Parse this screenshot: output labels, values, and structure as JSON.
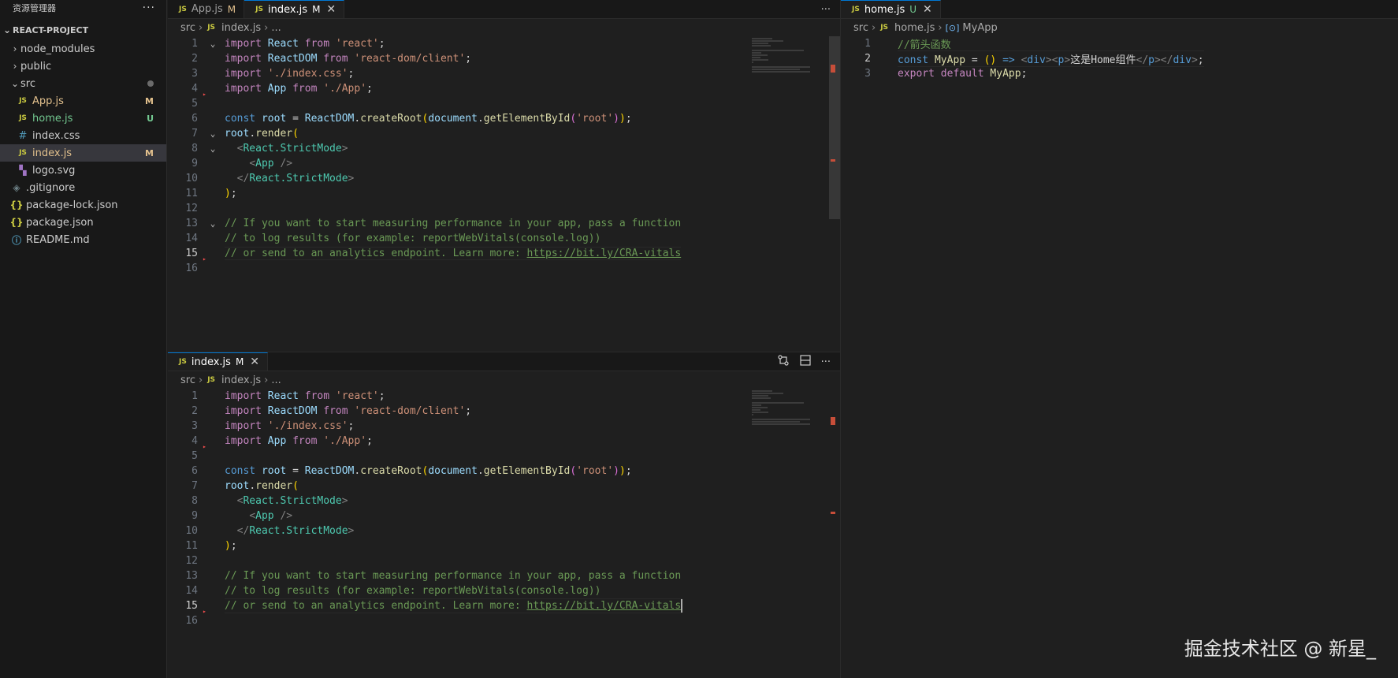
{
  "sidebar": {
    "title": "资源管理器",
    "more": "···",
    "project": "REACT-PROJECT",
    "items": [
      {
        "label": "node_modules",
        "type": "folder",
        "expanded": false
      },
      {
        "label": "public",
        "type": "folder",
        "expanded": false
      },
      {
        "label": "src",
        "type": "folder",
        "expanded": true
      },
      {
        "label": "App.js",
        "type": "js",
        "badge": "M"
      },
      {
        "label": "home.js",
        "type": "js",
        "badge": "U"
      },
      {
        "label": "index.css",
        "type": "css"
      },
      {
        "label": "index.js",
        "type": "js",
        "badge": "M"
      },
      {
        "label": "logo.svg",
        "type": "svg"
      },
      {
        "label": ".gitignore",
        "type": "git"
      },
      {
        "label": "package-lock.json",
        "type": "json"
      },
      {
        "label": "package.json",
        "type": "json"
      },
      {
        "label": "README.md",
        "type": "info"
      }
    ]
  },
  "icons": {
    "js": "JS",
    "css": "#",
    "json": "{}",
    "svg": "svg-file-icon",
    "info": "info-icon",
    "git": "git-icon",
    "chevron_right": "›",
    "chevron_down": "⌄",
    "close": "✕",
    "more": "···",
    "symbol": "[⊙]"
  },
  "editor_top": {
    "tabs": [
      {
        "label": "App.js",
        "status": "M",
        "active": false
      },
      {
        "label": "index.js",
        "status": "M",
        "active": true
      }
    ],
    "breadcrumb": {
      "folder": "src",
      "file": "index.js",
      "tail": "..."
    }
  },
  "editor_bottom": {
    "tabs": [
      {
        "label": "index.js",
        "status": "M",
        "active": true
      }
    ],
    "breadcrumb": {
      "folder": "src",
      "file": "index.js",
      "tail": "..."
    }
  },
  "editor_right": {
    "tabs": [
      {
        "label": "home.js",
        "status": "U",
        "active": true
      }
    ],
    "breadcrumb": {
      "folder": "src",
      "file": "home.js",
      "symbol": "MyApp"
    }
  },
  "index_code": [
    [
      [
        "kw",
        "import"
      ],
      [
        "pl",
        " "
      ],
      [
        "id",
        "React"
      ],
      [
        "pl",
        " "
      ],
      [
        "kw",
        "from"
      ],
      [
        "pl",
        " "
      ],
      [
        "str",
        "'react'"
      ],
      [
        "pl",
        ";"
      ]
    ],
    [
      [
        "kw",
        "import"
      ],
      [
        "pl",
        " "
      ],
      [
        "id",
        "ReactDOM"
      ],
      [
        "pl",
        " "
      ],
      [
        "kw",
        "from"
      ],
      [
        "pl",
        " "
      ],
      [
        "str",
        "'react-dom/client'"
      ],
      [
        "pl",
        ";"
      ]
    ],
    [
      [
        "kw",
        "import"
      ],
      [
        "pl",
        " "
      ],
      [
        "str",
        "'./index.css'"
      ],
      [
        "pl",
        ";"
      ]
    ],
    [
      [
        "kw",
        "import"
      ],
      [
        "pl",
        " "
      ],
      [
        "id",
        "App"
      ],
      [
        "pl",
        " "
      ],
      [
        "kw",
        "from"
      ],
      [
        "pl",
        " "
      ],
      [
        "str",
        "'./App'"
      ],
      [
        "pl",
        ";"
      ]
    ],
    [],
    [
      [
        "kw2",
        "const"
      ],
      [
        "pl",
        " "
      ],
      [
        "id",
        "root"
      ],
      [
        "pl",
        " = "
      ],
      [
        "id",
        "ReactDOM"
      ],
      [
        "pl",
        "."
      ],
      [
        "fn",
        "createRoot"
      ],
      [
        "br",
        "("
      ],
      [
        "id",
        "document"
      ],
      [
        "pl",
        "."
      ],
      [
        "fn",
        "getElementById"
      ],
      [
        "br2",
        "("
      ],
      [
        "str",
        "'root'"
      ],
      [
        "br2",
        ")"
      ],
      [
        "br",
        ")"
      ],
      [
        "pl",
        ";"
      ]
    ],
    [
      [
        "id",
        "root"
      ],
      [
        "pl",
        "."
      ],
      [
        "fn",
        "render"
      ],
      [
        "br",
        "("
      ]
    ],
    [
      [
        "pl",
        "  "
      ],
      [
        "tag",
        "<"
      ],
      [
        "tagn",
        "React.StrictMode"
      ],
      [
        "tag",
        ">"
      ]
    ],
    [
      [
        "pl",
        "    "
      ],
      [
        "tag",
        "<"
      ],
      [
        "tagn",
        "App"
      ],
      [
        "pl",
        " "
      ],
      [
        "tag",
        "/>"
      ]
    ],
    [
      [
        "pl",
        "  "
      ],
      [
        "tag",
        "</"
      ],
      [
        "tagn",
        "React.StrictMode"
      ],
      [
        "tag",
        ">"
      ]
    ],
    [
      [
        "br",
        ")"
      ],
      [
        "pl",
        ";"
      ]
    ],
    [],
    [
      [
        "cm",
        "// If you want to start measuring performance in your app, pass a function"
      ]
    ],
    [
      [
        "cm",
        "// to log results (for example: reportWebVitals(console.log))"
      ]
    ],
    [
      [
        "cm",
        "// or send to an analytics endpoint. Learn more: "
      ],
      [
        "url",
        "https://bit.ly/CRA-vitals"
      ]
    ],
    []
  ],
  "home_code": [
    [
      [
        "cm",
        "//箭头函数"
      ]
    ],
    [
      [
        "kw2",
        "const"
      ],
      [
        "pl",
        " "
      ],
      [
        "fn",
        "MyApp"
      ],
      [
        "pl",
        " = "
      ],
      [
        "br",
        "()"
      ],
      [
        "pl",
        " "
      ],
      [
        "kw2",
        "=>"
      ],
      [
        "pl",
        " "
      ],
      [
        "tag",
        "<"
      ],
      [
        "tagh",
        "div"
      ],
      [
        "tag",
        "><"
      ],
      [
        "tagh",
        "p"
      ],
      [
        "tag",
        ">"
      ],
      [
        "txt",
        "这是Home组件"
      ],
      [
        "tag",
        "</"
      ],
      [
        "tagh",
        "p"
      ],
      [
        "tag",
        "></"
      ],
      [
        "tagh",
        "div"
      ],
      [
        "tag",
        ">"
      ],
      [
        "pl",
        ";"
      ]
    ],
    [
      [
        "kw",
        "export"
      ],
      [
        "pl",
        " "
      ],
      [
        "kw",
        "default"
      ],
      [
        "pl",
        " "
      ],
      [
        "fn",
        "MyApp"
      ],
      [
        "pl",
        ";"
      ]
    ]
  ],
  "watermark": "掘金技术社区 @ 新星_"
}
